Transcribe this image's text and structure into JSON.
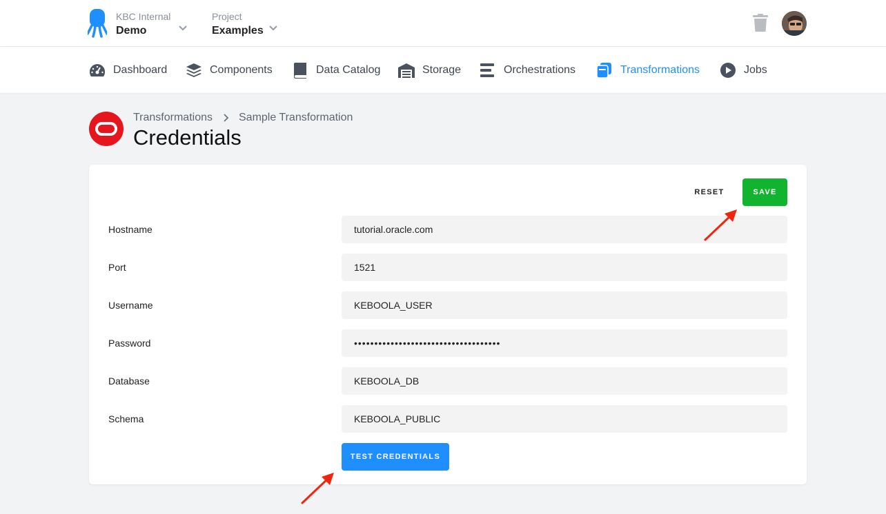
{
  "topbar": {
    "org_label": "KBC Internal",
    "org_value": "Demo",
    "project_label": "Project",
    "project_value": "Examples"
  },
  "nav": {
    "items": [
      {
        "label": "Dashboard",
        "icon": "gauge-icon"
      },
      {
        "label": "Components",
        "icon": "layers-icon"
      },
      {
        "label": "Data Catalog",
        "icon": "book-icon"
      },
      {
        "label": "Storage",
        "icon": "warehouse-icon"
      },
      {
        "label": "Orchestrations",
        "icon": "bars-icon"
      },
      {
        "label": "Transformations",
        "icon": "transformations-icon",
        "active": true
      },
      {
        "label": "Jobs",
        "icon": "play-circle-icon"
      }
    ],
    "active_color": "#1f8fff"
  },
  "breadcrumb": {
    "parent": "Transformations",
    "current": "Sample Transformation"
  },
  "page": {
    "title": "Credentials"
  },
  "actions": {
    "reset_label": "RESET",
    "save_label": "SAVE",
    "test_label": "TEST CREDENTIALS"
  },
  "form": {
    "fields": [
      {
        "label": "Hostname",
        "value": "tutorial.oracle.com"
      },
      {
        "label": "Port",
        "value": "1521"
      },
      {
        "label": "Username",
        "value": "KEBOOLA_USER"
      },
      {
        "label": "Password",
        "value": "••••••••••••••••••••••••••••••••••••"
      },
      {
        "label": "Database",
        "value": "KEBOOLA_DB"
      },
      {
        "label": "Schema",
        "value": "KEBOOLA_PUBLIC"
      }
    ]
  },
  "colors": {
    "save": "#12b32e",
    "test": "#1f8fff",
    "oracle": "#e5161d",
    "annotation_arrow": "#f0250f"
  }
}
